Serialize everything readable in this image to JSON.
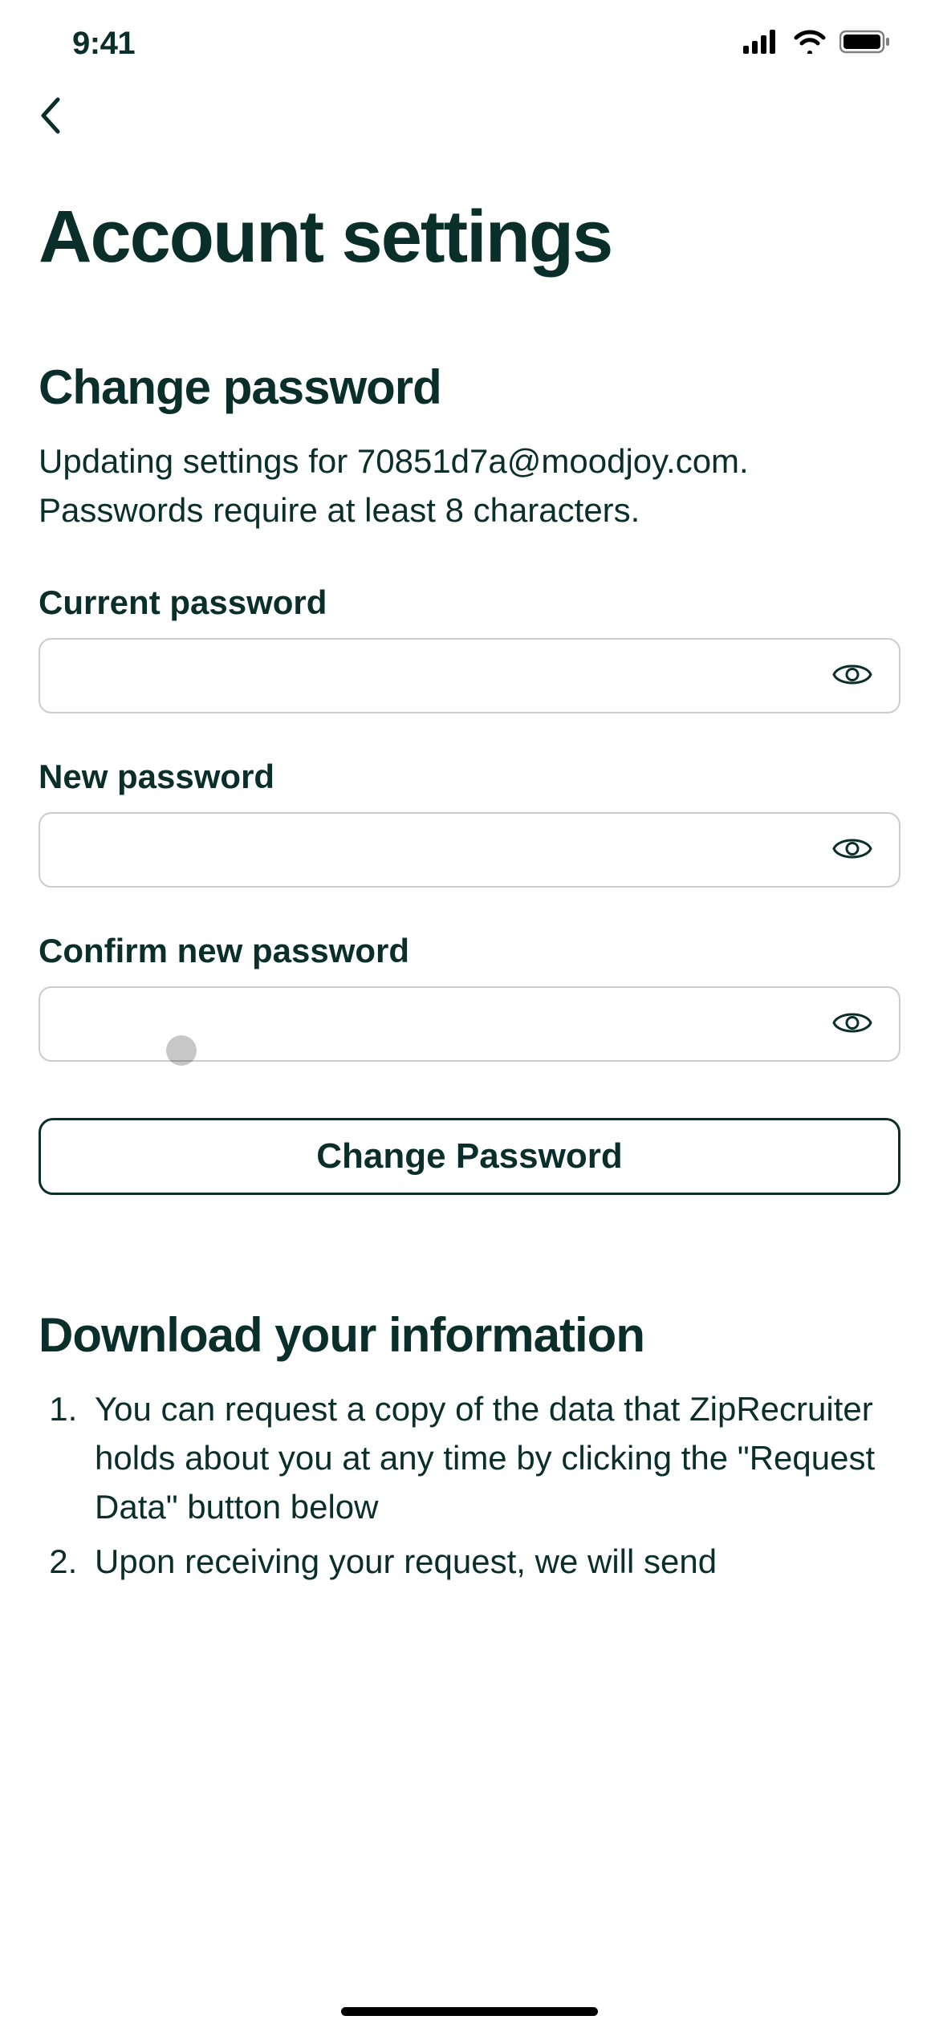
{
  "statusBar": {
    "time": "9:41"
  },
  "pageTitle": "Account settings",
  "changePassword": {
    "heading": "Change password",
    "description": "Updating settings for 70851d7a@moodjoy.com. Passwords require at least 8 characters.",
    "currentPasswordLabel": "Current password",
    "currentPasswordValue": "",
    "newPasswordLabel": "New password",
    "newPasswordValue": "",
    "confirmPasswordLabel": "Confirm new password",
    "confirmPasswordValue": "",
    "submitLabel": "Change Password"
  },
  "downloadInfo": {
    "heading": "Download your information",
    "items": [
      "You can request a copy of the data that ZipRecruiter holds about you at any time by clicking the \"Request Data\" button below",
      "Upon receiving your request, we will send"
    ]
  }
}
